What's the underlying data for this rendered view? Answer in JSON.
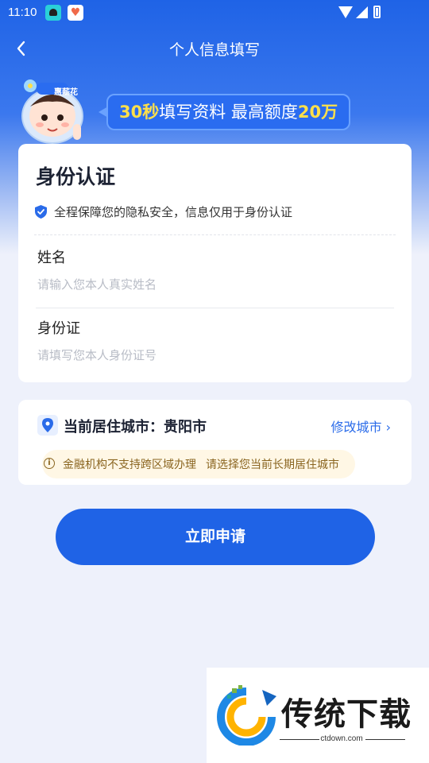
{
  "status_bar": {
    "time": "11:10"
  },
  "nav": {
    "title": "个人信息填写"
  },
  "banner": {
    "mascot_badge": "惠薪花",
    "promo_part1": "30秒",
    "promo_part2": "填写资料  最高额度",
    "promo_part3": "20万"
  },
  "id_card": {
    "title": "身份认证",
    "privacy_note": "全程保障您的隐私安全，信息仅用于身份认证",
    "name_label": "姓名",
    "name_placeholder": "请输入您本人真实姓名",
    "id_label": "身份证",
    "id_placeholder": "请填写您本人身份证号"
  },
  "city_card": {
    "city_text": "当前居住城市：贵阳市",
    "change_label": "修改城市 ›",
    "tip_part1": "金融机构不支持跨区域办理",
    "tip_part2": "请选择您当前长期居住城市"
  },
  "submit": {
    "label": "立即申请"
  },
  "watermark": {
    "brand": "传统下载",
    "site": "ctdown.com"
  },
  "colors": {
    "primary": "#1f63e6",
    "accent_yellow": "#ffe04a",
    "tip_bg": "#fff7e5",
    "tip_text": "#8a6520"
  },
  "icons": [
    "back-arrow-icon",
    "wifi-icon",
    "signal-icon",
    "battery-icon",
    "shield-check-icon",
    "location-pin-icon",
    "info-icon"
  ]
}
